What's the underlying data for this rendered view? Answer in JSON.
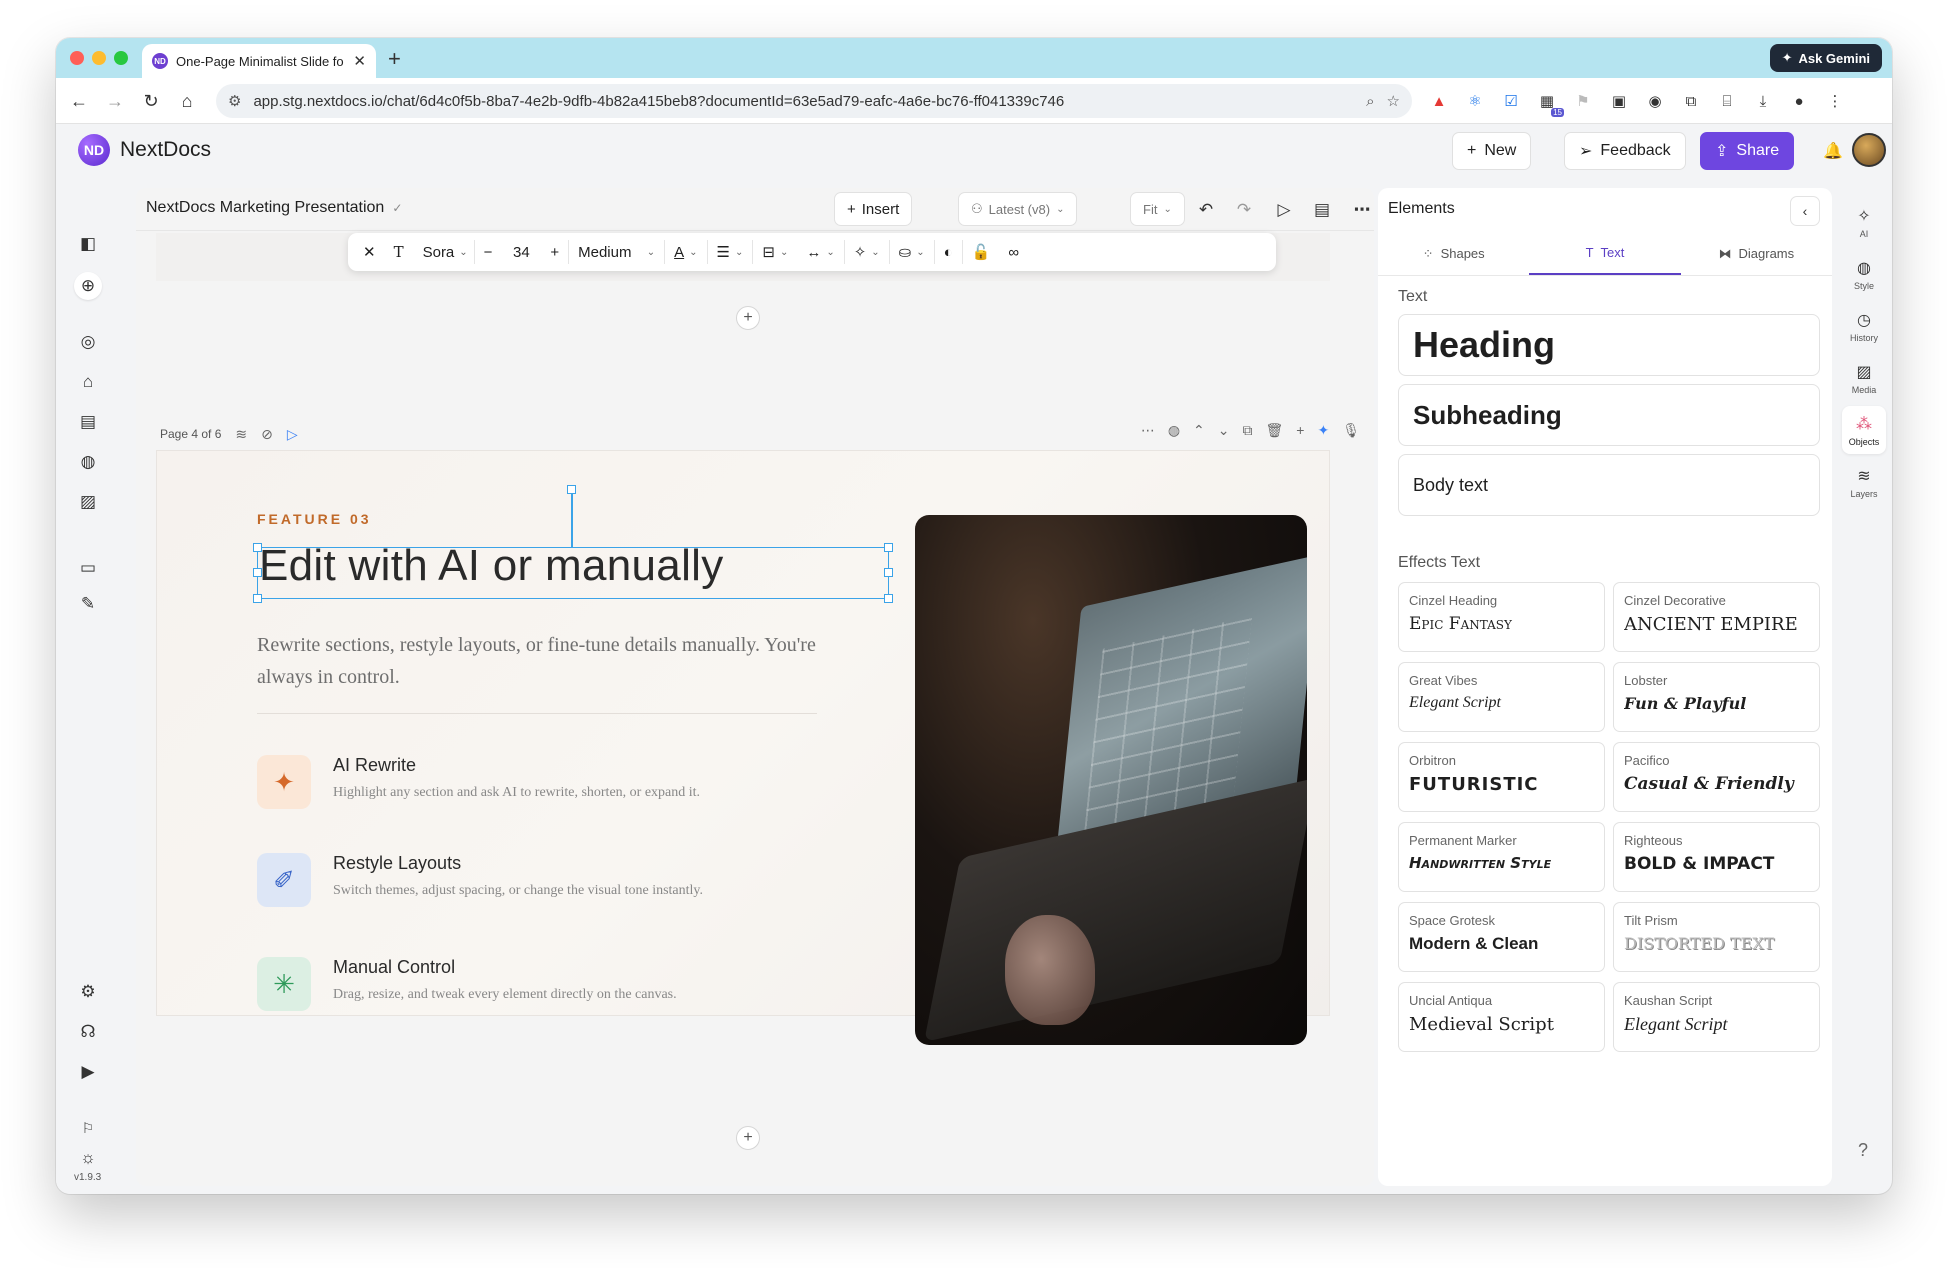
{
  "browser": {
    "tab_title": "One-Page Minimalist Slide fo",
    "tab_favicon_text": "ND",
    "url": "app.stg.nextdocs.io/chat/6d4c0f5b-8ba7-4e2b-9dfb-4b82a415beb8?documentId=63e5ad79-eafc-4a6e-bc76-ff041339c746",
    "gemini_label": "Ask Gemini",
    "extension_badge": "15"
  },
  "app": {
    "brand": "NextDocs",
    "logo_text": "ND",
    "new_label": "New",
    "feedback_label": "Feedback",
    "share_label": "Share",
    "version": "v1.9.3"
  },
  "editor": {
    "doc_title": "NextDocs Marketing Presentation",
    "insert_label": "Insert",
    "version_label": "Latest (v8)",
    "zoom_label": "Fit",
    "format": {
      "font": "Sora",
      "size": "34",
      "weight": "Medium"
    },
    "page_indicator": "Page 4 of 6"
  },
  "slide": {
    "eyebrow": "FEATURE 03",
    "title": "Edit with AI or manually",
    "body": "Rewrite sections, restyle layouts, or fine-tune details manually. You're always in control.",
    "features": [
      {
        "title": "AI Rewrite",
        "desc": "Highlight any section and ask AI to rewrite, shorten, or expand it.",
        "icon": "sparkles-icon"
      },
      {
        "title": "Restyle Layouts",
        "desc": "Switch themes, adjust spacing, or change the visual tone instantly.",
        "icon": "brush-icon"
      },
      {
        "title": "Manual Control",
        "desc": "Drag, resize, and tweak every element directly on the canvas.",
        "icon": "cursor-click-icon"
      }
    ],
    "colors": {
      "eyebrow": "#c16a2a",
      "selection": "#3ba3e8"
    }
  },
  "elements_panel": {
    "title": "Elements",
    "tabs": [
      "Shapes",
      "Text",
      "Diagrams"
    ],
    "active_tab": "Text",
    "text_section": "Text",
    "text_items": [
      "Heading",
      "Subheading",
      "Body text"
    ],
    "effects_section": "Effects Text",
    "effects": [
      {
        "name": "Cinzel Heading",
        "sample": "Epic Fantasy"
      },
      {
        "name": "Cinzel Decorative",
        "sample": "ANCIENT EMPIRE"
      },
      {
        "name": "Great Vibes",
        "sample": "Elegant Script"
      },
      {
        "name": "Lobster",
        "sample": "Fun & Playful"
      },
      {
        "name": "Orbitron",
        "sample": "FUTURISTIC"
      },
      {
        "name": "Pacifico",
        "sample": "Casual & Friendly"
      },
      {
        "name": "Permanent Marker",
        "sample": "Handwritten Style"
      },
      {
        "name": "Righteous",
        "sample": "BOLD & IMPACT"
      },
      {
        "name": "Space Grotesk",
        "sample": "Modern & Clean"
      },
      {
        "name": "Tilt Prism",
        "sample": "DISTORTED TEXT"
      },
      {
        "name": "Uncial Antiqua",
        "sample": "Medieval Script"
      },
      {
        "name": "Kaushan Script",
        "sample": "Elegant Script"
      }
    ]
  },
  "right_rail": [
    "AI",
    "Style",
    "History",
    "Media",
    "Objects",
    "Layers"
  ],
  "right_rail_active": "Objects",
  "accent_color": "#6e46e0"
}
